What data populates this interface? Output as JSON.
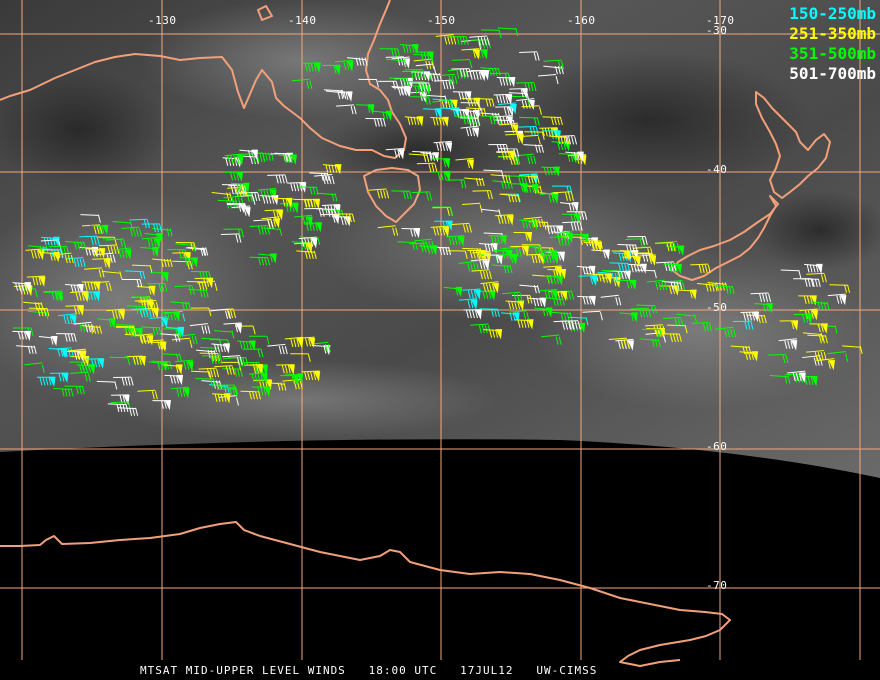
{
  "map": {
    "lon_labels": [
      "-130",
      "-140",
      "-150",
      "-160",
      "-170"
    ],
    "lat_labels": [
      "-30",
      "-40",
      "-50",
      "-60",
      "-70"
    ],
    "legend": [
      {
        "label": "150-250mb",
        "color": "#00ffff"
      },
      {
        "label": "251-350mb",
        "color": "#ffff00"
      },
      {
        "label": "351-500mb",
        "color": "#00ff00"
      },
      {
        "label": "501-700mb",
        "color": "#ffffff"
      }
    ],
    "caption": "MTSAT MID-UPPER LEVEL WINDS   18:00 UTC   17JUL12   UW-CIMSS",
    "colors": {
      "coast": "#f2a07a",
      "grid": "#f0a882",
      "night": "#000000"
    }
  }
}
